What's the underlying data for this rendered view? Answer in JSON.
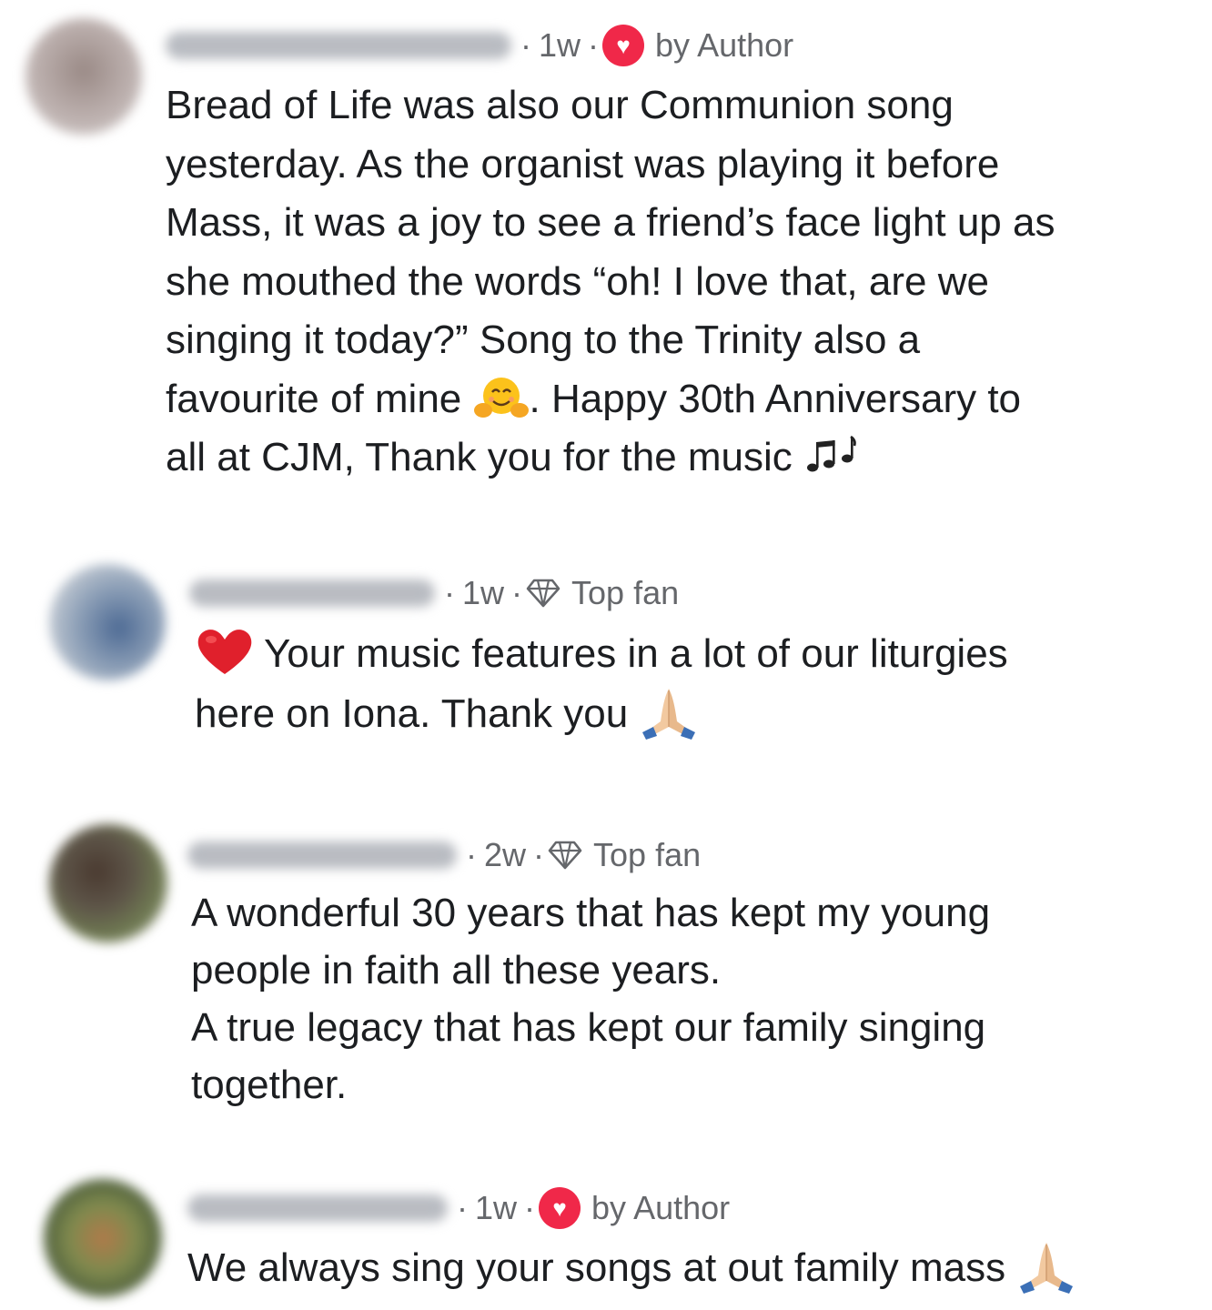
{
  "comments": [
    {
      "time": "1w",
      "badge": "by Author",
      "badge_icon": "heart-icon",
      "lines": [
        "Bread of Life was also our Communion song",
        "yesterday.  As the organist was playing it before",
        "Mass, it was a joy to see a friend’s face light up as",
        "she mouthed the words “oh! I love that, are we",
        "singing it today?” Song to the Trinity also a"
      ],
      "line6_before": "favourite of mine ",
      "line6_after": ". Happy 30th Anniversary to",
      "line7": "all at CJM, Thank you for the music "
    },
    {
      "time": "1w",
      "badge": "Top fan",
      "badge_icon": "diamond-icon",
      "line1": "Your music features in a lot of our liturgies",
      "line2": "here on Iona. Thank you "
    },
    {
      "time": "2w",
      "badge": "Top fan",
      "badge_icon": "diamond-icon",
      "lines": [
        "A wonderful 30 years that has kept my young",
        "people in faith all these years.",
        "A true legacy that has kept our family singing",
        "together."
      ]
    },
    {
      "time": "1w",
      "badge": "by Author",
      "badge_icon": "heart-icon",
      "line1": "We always sing your songs at out family mass "
    }
  ],
  "colors": {
    "meta_text": "#65676b",
    "body_text": "#1c1e21",
    "author_badge": "#f02849"
  },
  "icons": [
    "hugging-face-emoji",
    "musical-notes-emoji",
    "red-heart-emoji",
    "folded-hands-emoji",
    "heart-icon",
    "diamond-icon"
  ]
}
